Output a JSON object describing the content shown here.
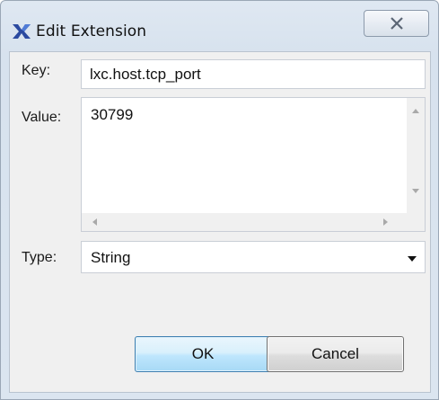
{
  "window": {
    "title": "Edit Extension",
    "icon": "app-logo-icon",
    "close_icon": "close-icon"
  },
  "form": {
    "key_label": "Key:",
    "key_value": "lxc.host.tcp_port",
    "value_label": "Value:",
    "value_text": "30799",
    "type_label": "Type:",
    "type_selected": "String"
  },
  "buttons": {
    "ok_label": "OK",
    "cancel_label": "Cancel"
  },
  "colors": {
    "accent": "#3c7fb1",
    "titlebar": "#dfe8f2",
    "client_bg": "#f0f0f0"
  }
}
